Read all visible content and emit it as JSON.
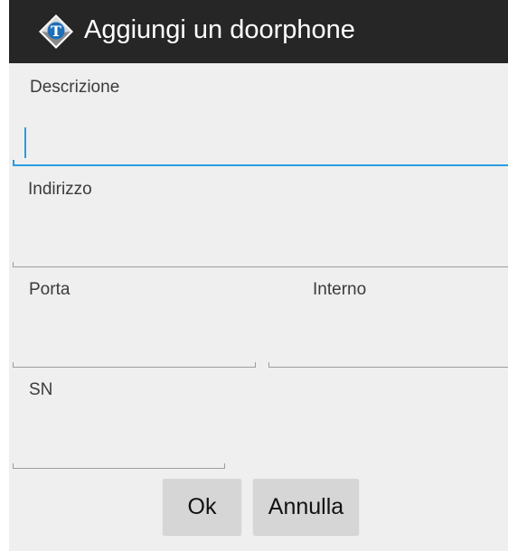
{
  "dialog": {
    "title": "Aggiungi un doorphone"
  },
  "fields": {
    "descrizione": {
      "label": "Descrizione",
      "value": ""
    },
    "indirizzo": {
      "label": "Indirizzo",
      "value": ""
    },
    "porta": {
      "label": "Porta",
      "value": ""
    },
    "interno": {
      "label": "Interno",
      "value": ""
    },
    "sn": {
      "label": "SN",
      "value": ""
    }
  },
  "buttons": {
    "ok": "Ok",
    "annulla": "Annulla"
  },
  "colors": {
    "titlebar": "#262626",
    "background": "#efefef",
    "accent": "#2a9ce0",
    "button": "#d6d6d6"
  },
  "icons": {
    "app": "t-diamond-app-icon"
  }
}
